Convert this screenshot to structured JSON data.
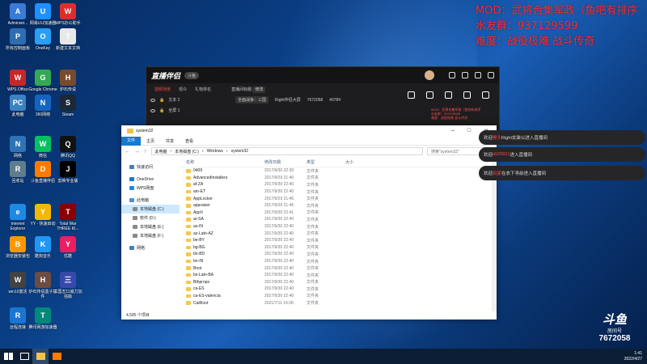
{
  "overlay": {
    "line1": "MOD：武将合集军政（鱼吧有排序",
    "line2": "水友群：937129599",
    "line3": "难度：战役极难 战斗传奇"
  },
  "desktop_icons": [
    {
      "label": "Administr...",
      "color": "#3a7bd5",
      "glyph": "A"
    },
    {
      "label": "网易UU加速器",
      "color": "#1e90ff",
      "glyph": "U"
    },
    {
      "label": "WPS办公助手",
      "color": "#d9302c",
      "glyph": "W"
    },
    {
      "label": "所有控制面板",
      "color": "#2f6db3",
      "glyph": "P"
    },
    {
      "label": "OneKey",
      "color": "#2a9df4",
      "glyph": "O"
    },
    {
      "label": "新建文本文档",
      "color": "#e8e8e8",
      "glyph": "T"
    },
    {
      "label": "WPS Office",
      "color": "#c62828",
      "glyph": "W"
    },
    {
      "label": "Google Chrome",
      "color": "#34a853",
      "glyph": "G"
    },
    {
      "label": "炉石传说",
      "color": "#7a4b2a",
      "glyph": "H"
    },
    {
      "label": "此电脑",
      "color": "#3b82c4",
      "glyph": "PC"
    },
    {
      "label": "360网络",
      "color": "#1565c0",
      "glyph": "N"
    },
    {
      "label": "Steam",
      "color": "#1b2838",
      "glyph": "S"
    },
    {
      "label": "网络",
      "color": "#2e74b5",
      "glyph": "N"
    },
    {
      "label": "微信",
      "color": "#07c160",
      "glyph": "W"
    },
    {
      "label": "腾讯QQ",
      "color": "#111111",
      "glyph": "Q"
    },
    {
      "label": "回收站",
      "color": "#607d8b",
      "glyph": "R"
    },
    {
      "label": "斗鱼直播伴侣",
      "color": "#ff7a00",
      "glyph": "D"
    },
    {
      "label": "剪映专业版",
      "color": "#000000",
      "glyph": "J"
    },
    {
      "label": "Internet Explorer",
      "color": "#1e88e5",
      "glyph": "e"
    },
    {
      "label": "YY - 快速启动",
      "color": "#f5b800",
      "glyph": "Y"
    },
    {
      "label": "Total War THREE KI...",
      "color": "#8b0000",
      "glyph": "T"
    },
    {
      "label": "浏览器安装包",
      "color": "#ff9800",
      "glyph": "B"
    },
    {
      "label": "酷狗音乐",
      "color": "#2196f3",
      "glyph": "K"
    },
    {
      "label": "优酷",
      "color": "#e91e63",
      "glyph": "Y"
    },
    {
      "label": "win10激活",
      "color": "#424242",
      "glyph": "W"
    },
    {
      "label": "炉石传说盒子插件",
      "color": "#6d4c41",
      "glyph": "H"
    },
    {
      "label": "三国志11威力加强版",
      "color": "#3949ab",
      "glyph": "三"
    },
    {
      "label": "远程连接",
      "color": "#1976d2",
      "glyph": "R"
    },
    {
      "label": "腾讯网游加速器",
      "color": "#00897b",
      "glyph": "T"
    }
  ],
  "stream_app": {
    "logo": "直播伴侣",
    "badge": "斗鱼",
    "tabs": [
      "视频场景",
      "观众",
      "礼物排名"
    ],
    "active_tab": "视频场景",
    "scenes": [
      "文本 2",
      "全屏 1"
    ],
    "room_title": "直播间标题",
    "room_title_badge": "修改",
    "room_category": "全面战争：三国",
    "room_category_suffix": "Right伴侣大屏",
    "room_id": "7672058",
    "viewer_count": "40784",
    "preview_lines": [
      "MOD：武将合集军政（鱼吧有排序",
      "水友群：937129599",
      "难度：战役极难 战斗传奇"
    ]
  },
  "explorer": {
    "title": "system32",
    "ribbon": [
      "文件",
      "主页",
      "共享",
      "查看"
    ],
    "breadcrumb": [
      "此电脑",
      "本地磁盘 (C:)",
      "Windows",
      "system32"
    ],
    "search_placeholder": "搜索\"system32\"",
    "nav_items": [
      {
        "label": "快速访问",
        "color": "#3b82c4",
        "indent": false,
        "selected": false
      },
      {
        "label": "OneDrive",
        "color": "#1976d2",
        "indent": false,
        "selected": false
      },
      {
        "label": "WPS网盘",
        "color": "#1e88e5",
        "indent": false,
        "selected": false
      },
      {
        "label": "此电脑",
        "color": "#4a90d9",
        "indent": false,
        "selected": false
      },
      {
        "label": "本地磁盘 (C:)",
        "color": "#888888",
        "indent": true,
        "selected": true
      },
      {
        "label": "软件 (D:)",
        "color": "#888888",
        "indent": true,
        "selected": false
      },
      {
        "label": "本地磁盘 (E:)",
        "color": "#888888",
        "indent": true,
        "selected": false
      },
      {
        "label": "本地磁盘 (F:)",
        "color": "#888888",
        "indent": true,
        "selected": false
      },
      {
        "label": "网络",
        "color": "#3b82c4",
        "indent": false,
        "selected": false
      }
    ],
    "columns": {
      "name": "名称",
      "date": "修改日期",
      "type": "类型",
      "size": "大小"
    },
    "rows": [
      {
        "name": "0409",
        "date": "2017/9/30 22:39",
        "type": "文件夹"
      },
      {
        "name": "AdvancedInstallers",
        "date": "2017/9/29 21:46",
        "type": "文件夹"
      },
      {
        "name": "af-ZA",
        "date": "2017/9/30 22:40",
        "type": "文件夹"
      },
      {
        "name": "am-ET",
        "date": "2017/9/30 22:40",
        "type": "文件夹"
      },
      {
        "name": "AppLocker",
        "date": "2017/9/29 21:46",
        "type": "文件夹"
      },
      {
        "name": "appraiser",
        "date": "2017/9/29 21:46",
        "type": "文件夹"
      },
      {
        "name": "AppV",
        "date": "2017/9/30 22:41",
        "type": "文件夹"
      },
      {
        "name": "ar-SA",
        "date": "2017/9/30 22:40",
        "type": "文件夹"
      },
      {
        "name": "as-IN",
        "date": "2017/9/30 22:40",
        "type": "文件夹"
      },
      {
        "name": "az-Latn-AZ",
        "date": "2017/9/30 22:40",
        "type": "文件夹"
      },
      {
        "name": "be-BY",
        "date": "2017/9/30 22:40",
        "type": "文件夹"
      },
      {
        "name": "bg-BG",
        "date": "2017/9/30 22:40",
        "type": "文件夹"
      },
      {
        "name": "bn-BD",
        "date": "2017/9/30 22:40",
        "type": "文件夹"
      },
      {
        "name": "bn-IN",
        "date": "2017/9/30 22:40",
        "type": "文件夹"
      },
      {
        "name": "Boot",
        "date": "2017/9/30 22:40",
        "type": "文件夹"
      },
      {
        "name": "bs-Latn-BA",
        "date": "2017/9/30 22:40",
        "type": "文件夹"
      },
      {
        "name": "Bthprops",
        "date": "2017/9/30 22:40",
        "type": "文件夹"
      },
      {
        "name": "ca-ES",
        "date": "2017/9/30 22:40",
        "type": "文件夹"
      },
      {
        "name": "ca-ES-valencia",
        "date": "2017/9/30 22:40",
        "type": "文件夹"
      },
      {
        "name": "CatRoot",
        "date": "2021/7/11 14:28",
        "type": "文件夹"
      }
    ],
    "status": "4,585 个项目"
  },
  "chat": [
    {
      "prefix": "欢迎",
      "name": "骨头",
      "suffix": "Right女装以进入直播间"
    },
    {
      "prefix": "欢迎",
      "name": "a529921",
      "suffix": "进入直播间"
    },
    {
      "prefix": "欢迎",
      "name": "玩家",
      "suffix": "在衣下寻前进入直播间"
    }
  ],
  "douyu": {
    "brand": "斗鱼",
    "sub": "房间号",
    "room": "7672058"
  },
  "taskbar": {
    "time": "1:41",
    "date": "2022/4/27"
  }
}
